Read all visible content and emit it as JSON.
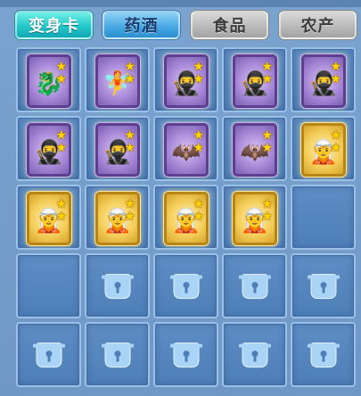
{
  "tabs": [
    {
      "label": "变身卡",
      "style": "active"
    },
    {
      "label": "药酒",
      "style": "blue"
    },
    {
      "label": "食品",
      "style": "gray"
    },
    {
      "label": "农产",
      "style": "gray"
    }
  ],
  "slots": [
    {
      "state": "card",
      "frame": "purple",
      "stars": 2,
      "icon": "dragon-card-icon",
      "glyph": "🐉"
    },
    {
      "state": "card",
      "frame": "purple",
      "stars": 2,
      "icon": "spirit-card-icon",
      "glyph": "🧚"
    },
    {
      "state": "card",
      "frame": "purple",
      "stars": 2,
      "icon": "warrior-card-icon",
      "glyph": "🥷"
    },
    {
      "state": "card",
      "frame": "purple",
      "stars": 2,
      "icon": "warrior-card-icon",
      "glyph": "🥷"
    },
    {
      "state": "card",
      "frame": "purple",
      "stars": 2,
      "icon": "warrior-card-icon",
      "glyph": "🥷"
    },
    {
      "state": "card",
      "frame": "purple",
      "stars": 2,
      "icon": "warrior-card-icon",
      "glyph": "🥷"
    },
    {
      "state": "card",
      "frame": "purple",
      "stars": 2,
      "icon": "warrior-card-icon",
      "glyph": "🥷"
    },
    {
      "state": "card",
      "frame": "purple",
      "stars": 2,
      "icon": "winged-demon-card-icon",
      "glyph": "🦇"
    },
    {
      "state": "card",
      "frame": "purple",
      "stars": 2,
      "icon": "winged-demon-card-icon",
      "glyph": "🦇"
    },
    {
      "state": "card",
      "frame": "gold",
      "stars": 2,
      "icon": "fairy-card-icon",
      "glyph": "🧝"
    },
    {
      "state": "card",
      "frame": "gold",
      "stars": 2,
      "icon": "fairy-card-icon",
      "glyph": "🧝"
    },
    {
      "state": "card",
      "frame": "gold",
      "stars": 2,
      "icon": "fairy-card-icon",
      "glyph": "🧝"
    },
    {
      "state": "card",
      "frame": "gold",
      "stars": 2,
      "icon": "fairy-card-icon",
      "glyph": "🧝"
    },
    {
      "state": "card",
      "frame": "gold",
      "stars": 2,
      "icon": "fairy-card-icon",
      "glyph": "🧝"
    },
    {
      "state": "empty"
    },
    {
      "state": "empty"
    },
    {
      "state": "locked"
    },
    {
      "state": "locked"
    },
    {
      "state": "locked"
    },
    {
      "state": "locked"
    },
    {
      "state": "locked"
    },
    {
      "state": "locked"
    },
    {
      "state": "locked"
    },
    {
      "state": "locked"
    },
    {
      "state": "locked"
    }
  ],
  "colors": {
    "active_tab": "#24c8c9",
    "blue_tab": "#45a7e3",
    "gray_tab": "#b8b8b8",
    "slot_bg": "#5e8dc4",
    "star": "#ffd400",
    "lock": "#a9d4f5"
  }
}
